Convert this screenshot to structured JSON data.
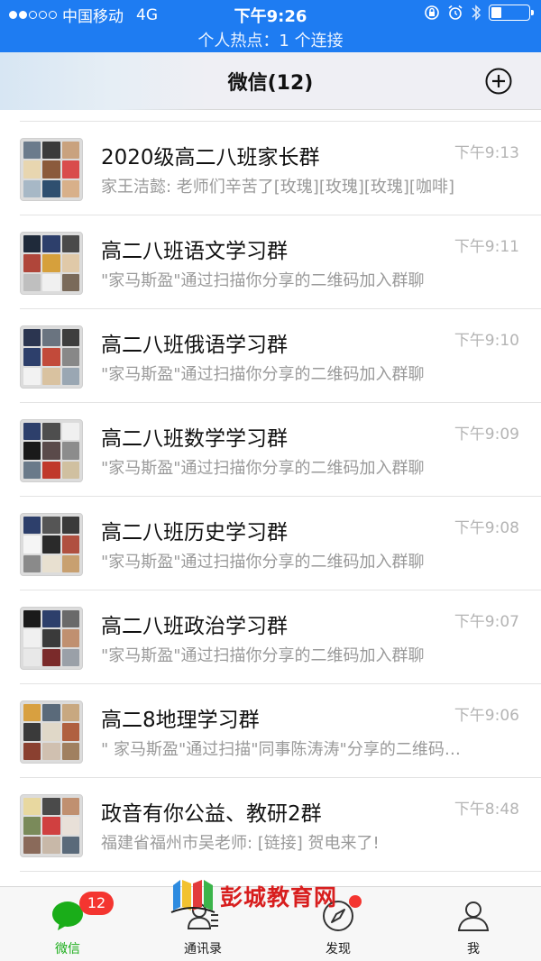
{
  "status_bar": {
    "carrier": "中国移动",
    "network": "4G",
    "time": "下午9:26",
    "hotspot": "个人热点：1 个连接"
  },
  "header": {
    "title": "微信(12)",
    "add_icon": "plus-circle-icon"
  },
  "chats": [
    {
      "name": "2020级高二八班家长群",
      "time": "下午9:13",
      "message": "家王洁懿: 老师们辛苦了[玫瑰][玫瑰][玫瑰][咖啡]"
    },
    {
      "name": "高二八班语文学习群",
      "time": "下午9:11",
      "message": "\"家马斯盈\"通过扫描你分享的二维码加入群聊"
    },
    {
      "name": "高二八班俄语学习群",
      "time": "下午9:10",
      "message": "\"家马斯盈\"通过扫描你分享的二维码加入群聊"
    },
    {
      "name": "高二八班数学学习群",
      "time": "下午9:09",
      "message": "\"家马斯盈\"通过扫描你分享的二维码加入群聊"
    },
    {
      "name": "高二八班历史学习群",
      "time": "下午9:08",
      "message": "\"家马斯盈\"通过扫描你分享的二维码加入群聊"
    },
    {
      "name": "高二八班政治学习群",
      "time": "下午9:07",
      "message": "\"家马斯盈\"通过扫描你分享的二维码加入群聊"
    },
    {
      "name": "高二8地理学习群",
      "time": "下午9:06",
      "message": "\" 家马斯盈\"通过扫描\"同事陈涛涛\"分享的二维码…"
    },
    {
      "name": "政音有你公益、教研2群",
      "time": "下午8:48",
      "message": "福建省福州市吴老师: [链接] 贺电来了!"
    }
  ],
  "tabs": [
    {
      "label": "微信",
      "icon": "chat-bubble-icon",
      "badge": "12",
      "active": true
    },
    {
      "label": "通讯录",
      "icon": "contacts-icon"
    },
    {
      "label": "发现",
      "icon": "compass-icon",
      "dot": true
    },
    {
      "label": "我",
      "icon": "person-icon"
    }
  ],
  "watermark": {
    "text": "彭城教育网"
  },
  "colors": {
    "status_bar": "#1e7cf2",
    "active_tab": "#1aad19",
    "badge": "#f43530"
  }
}
